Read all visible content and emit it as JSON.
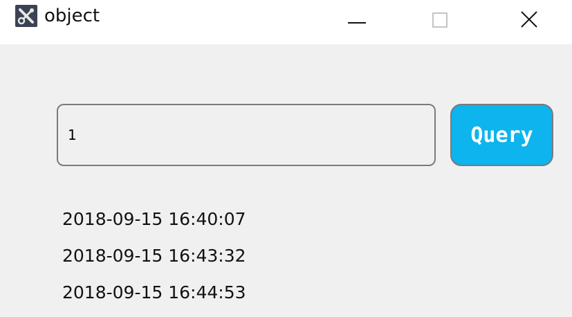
{
  "window": {
    "title": "object",
    "icon": "tools-icon"
  },
  "controls": {
    "minimize_icon": "minimize-icon",
    "maximize_icon": "maximize-icon",
    "close_icon": "close-icon"
  },
  "form": {
    "input_value": "1",
    "button_label": "Query",
    "button_color": "#0db4ee"
  },
  "results": [
    "2018-09-15 16:40:07",
    "2018-09-15 16:43:32",
    "2018-09-15 16:44:53"
  ]
}
